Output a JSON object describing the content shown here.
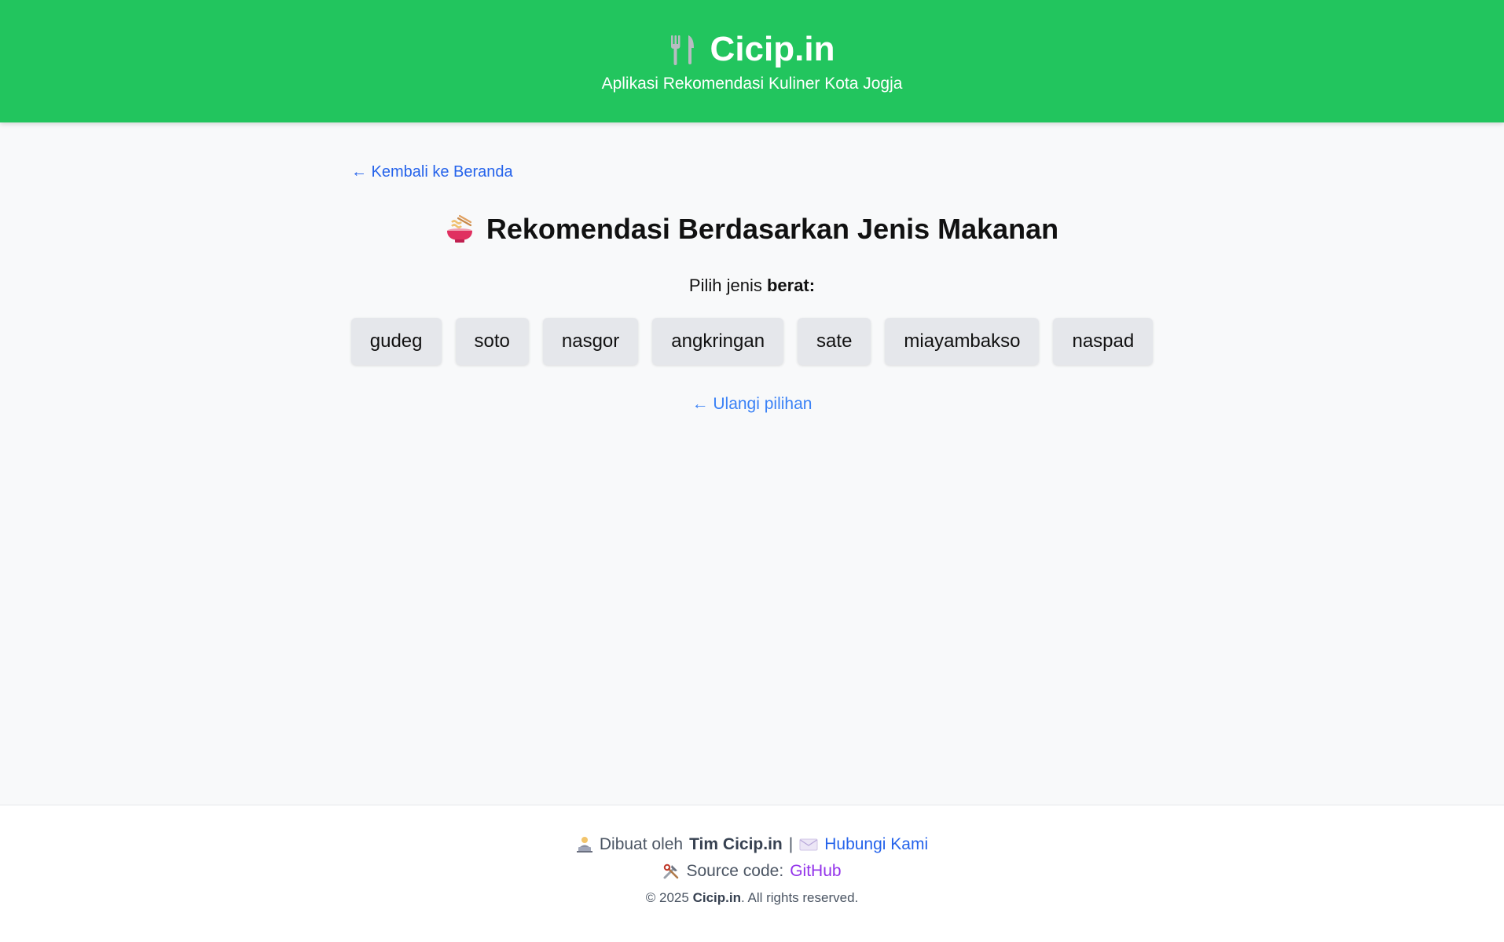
{
  "header": {
    "title": "Cicip.in",
    "tagline": "Aplikasi Rekomendasi Kuliner Kota Jogja",
    "icon": "fork-knife-icon"
  },
  "main": {
    "back_link": "← Kembali ke Beranda",
    "title": "Rekomendasi Berdasarkan Jenis Makanan",
    "title_icon": "noodle-bowl-icon",
    "prompt_prefix": "Pilih jenis ",
    "prompt_bold": "berat",
    "prompt_suffix": ":",
    "options": [
      "gudeg",
      "soto",
      "nasgor",
      "angkringan",
      "sate",
      "miayambakso",
      "naspad"
    ],
    "retry_link": "← Ulangi pilihan"
  },
  "footer": {
    "made_by_prefix": "Dibuat oleh",
    "team": "Tim Cicip.in",
    "separator": "|",
    "contact": "Hubungi Kami",
    "source_prefix": "Source code:",
    "source_link": "GitHub",
    "copyright_prefix": "© 2025",
    "copyright_brand": "Cicip.in",
    "copyright_suffix": ". All rights reserved."
  },
  "colors": {
    "header_bg": "#22c55e",
    "link_blue": "#2563eb",
    "link_purple": "#9333ea",
    "button_bg": "#e5e7eb"
  }
}
